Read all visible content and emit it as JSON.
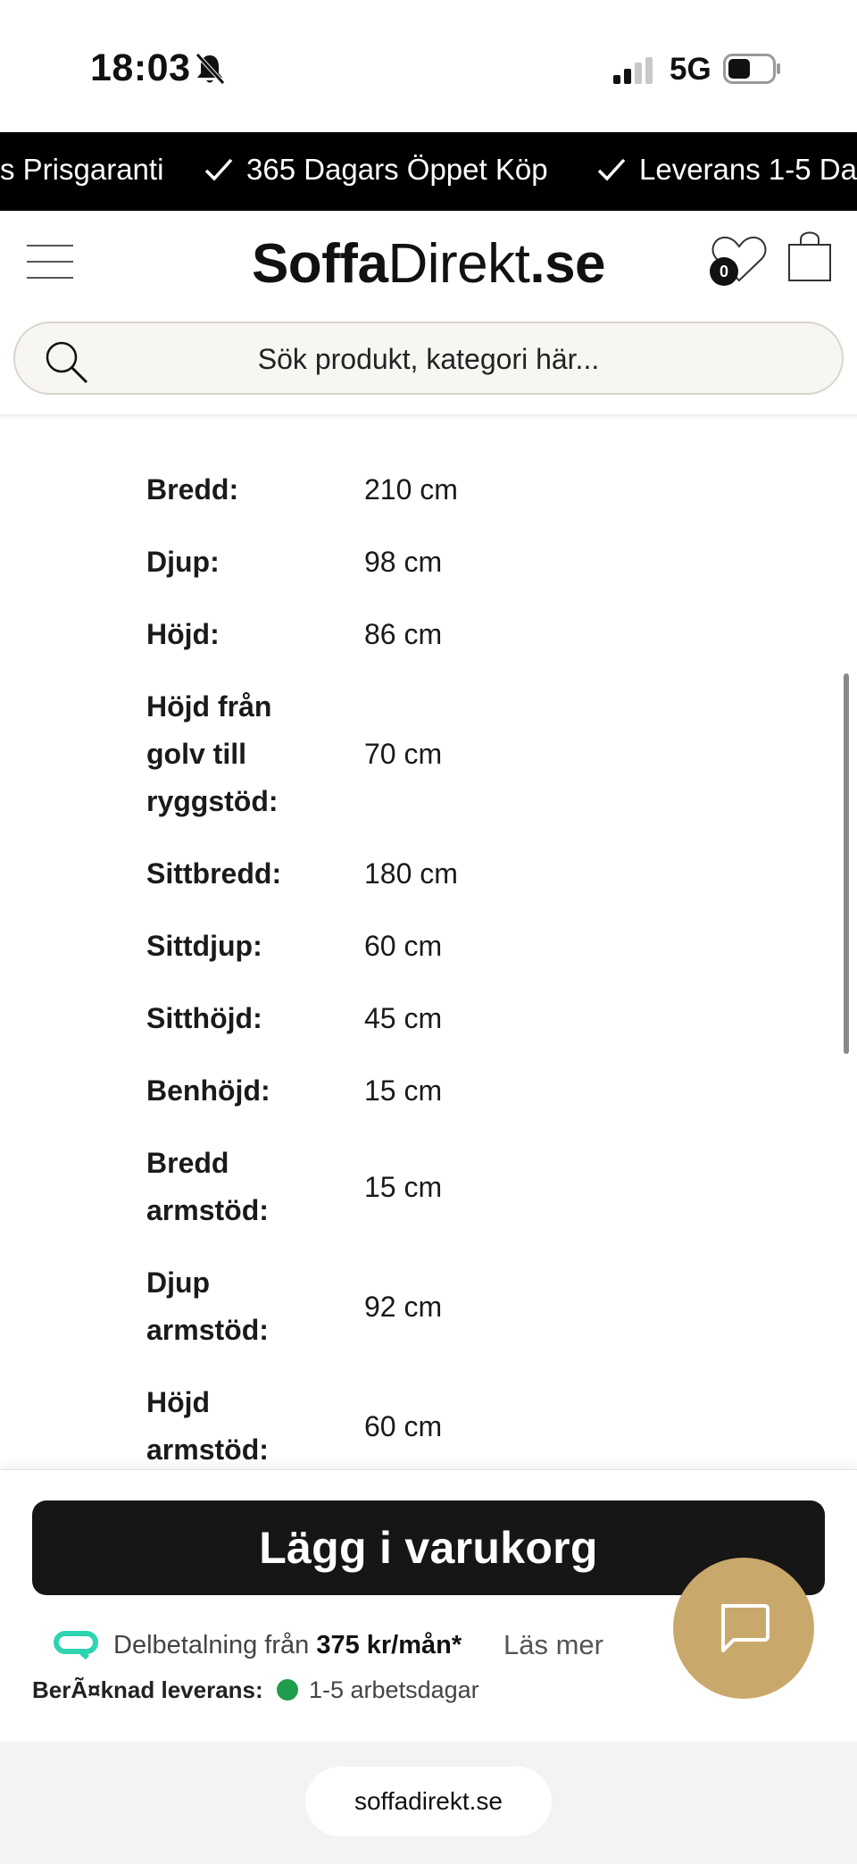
{
  "status_bar": {
    "time": "18:03",
    "network": "5G"
  },
  "promo": {
    "items": [
      "s Prisgaranti",
      "365 Dagars Öppet Köp",
      "Leverans 1-5 Da"
    ]
  },
  "header": {
    "logo_bold_1": "Soffa",
    "logo_thin": "Direkt",
    "logo_bold_2": ".se",
    "wishlist_count": "0"
  },
  "search": {
    "placeholder": "Sök produkt, kategori här..."
  },
  "specs": [
    {
      "label": "Bredd:",
      "value": "210 cm"
    },
    {
      "label": "Djup:",
      "value": "98 cm"
    },
    {
      "label": "Höjd:",
      "value": "86 cm"
    },
    {
      "label": "Höjd från golv till ryggstöd:",
      "value": "70 cm"
    },
    {
      "label": "Sittbredd:",
      "value": "180 cm"
    },
    {
      "label": "Sittdjup:",
      "value": "60 cm"
    },
    {
      "label": "Sitthöjd:",
      "value": "45 cm"
    },
    {
      "label": "Benhöjd:",
      "value": "15 cm"
    },
    {
      "label": "Bredd armstöd:",
      "value": "15 cm"
    },
    {
      "label": "Djup armstöd:",
      "value": "92 cm"
    },
    {
      "label": "Höjd armstöd:",
      "value": "60 cm"
    }
  ],
  "bottom_panel": {
    "add_to_cart": "Lägg i varukorg",
    "installment_prefix": "Delbetalning från ",
    "installment_amount": "375 kr/mån*",
    "read_more": "Läs mer",
    "delivery_label": "BerÃ¤knad leverans:",
    "delivery_value": "1-5 arbetsdagar"
  },
  "browser": {
    "url": "soffadirekt.se"
  },
  "colors": {
    "promo_bg": "#000000",
    "button_bg": "#161616",
    "chat_bg": "#c9a96b",
    "delivery_dot": "#1f9d4c",
    "klarna": "#2ed3b0"
  }
}
